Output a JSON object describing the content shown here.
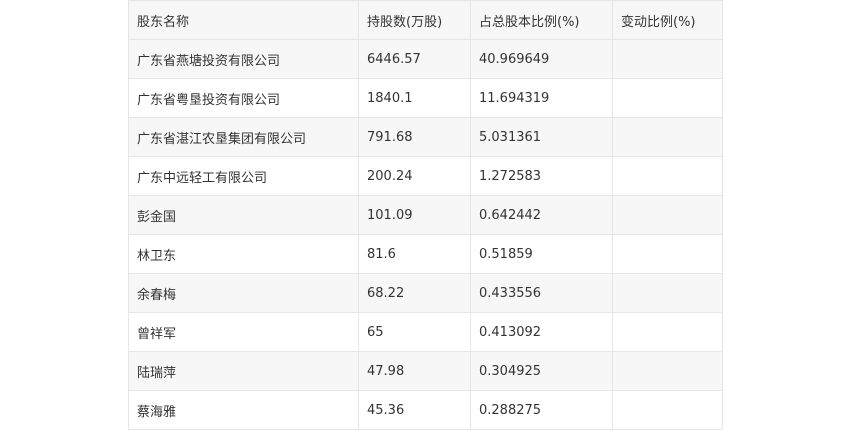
{
  "table": {
    "headers": [
      "股东名称",
      "持股数(万股)",
      "占总股本比例(%)",
      "变动比例(%)"
    ],
    "rows": [
      [
        "广东省燕塘投资有限公司",
        "6446.57",
        "40.969649",
        ""
      ],
      [
        "广东省粤垦投资有限公司",
        "1840.1",
        "11.694319",
        ""
      ],
      [
        "广东省湛江农垦集团有限公司",
        "791.68",
        "5.031361",
        ""
      ],
      [
        "广东中远轻工有限公司",
        "200.24",
        "1.272583",
        ""
      ],
      [
        "彭金国",
        "101.09",
        "0.642442",
        ""
      ],
      [
        "林卫东",
        "81.6",
        "0.51859",
        ""
      ],
      [
        "余春梅",
        "68.22",
        "0.433556",
        ""
      ],
      [
        "曾祥军",
        "65",
        "0.413092",
        ""
      ],
      [
        "陆瑞萍",
        "47.98",
        "0.304925",
        ""
      ],
      [
        "蔡海雅",
        "45.36",
        "0.288275",
        ""
      ]
    ]
  }
}
